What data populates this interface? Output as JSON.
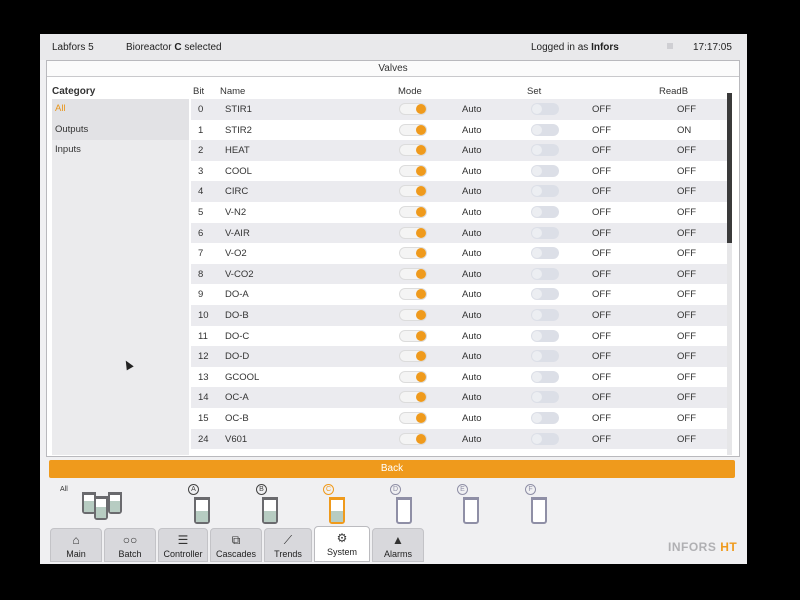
{
  "topbar": {
    "app_name": "Labfors 5",
    "bioreactor_prefix": "Bioreactor",
    "bioreactor_letter": "C",
    "bioreactor_suffix": "selected",
    "login_prefix": "Logged in as",
    "login_user": "Infors",
    "time": "17:17:05"
  },
  "panel": {
    "title": "Valves",
    "category_header": "Category",
    "categories": [
      {
        "label": "All",
        "active": true
      },
      {
        "label": "Outputs",
        "active": false
      },
      {
        "label": "Inputs",
        "active": false
      }
    ],
    "columns": {
      "bit": "Bit",
      "name": "Name",
      "mode": "Mode",
      "set": "Set",
      "readback": "ReadB"
    },
    "rows": [
      {
        "bit": "0",
        "name": "STIR1",
        "mode": "Auto",
        "set": "OFF",
        "readb": "OFF"
      },
      {
        "bit": "1",
        "name": "STIR2",
        "mode": "Auto",
        "set": "OFF",
        "readb": "ON"
      },
      {
        "bit": "2",
        "name": "HEAT",
        "mode": "Auto",
        "set": "OFF",
        "readb": "OFF"
      },
      {
        "bit": "3",
        "name": "COOL",
        "mode": "Auto",
        "set": "OFF",
        "readb": "OFF"
      },
      {
        "bit": "4",
        "name": "CIRC",
        "mode": "Auto",
        "set": "OFF",
        "readb": "OFF"
      },
      {
        "bit": "5",
        "name": "V-N2",
        "mode": "Auto",
        "set": "OFF",
        "readb": "OFF"
      },
      {
        "bit": "6",
        "name": "V-AIR",
        "mode": "Auto",
        "set": "OFF",
        "readb": "OFF"
      },
      {
        "bit": "7",
        "name": "V-O2",
        "mode": "Auto",
        "set": "OFF",
        "readb": "OFF"
      },
      {
        "bit": "8",
        "name": "V-CO2",
        "mode": "Auto",
        "set": "OFF",
        "readb": "OFF"
      },
      {
        "bit": "9",
        "name": "DO-A",
        "mode": "Auto",
        "set": "OFF",
        "readb": "OFF"
      },
      {
        "bit": "10",
        "name": "DO-B",
        "mode": "Auto",
        "set": "OFF",
        "readb": "OFF"
      },
      {
        "bit": "11",
        "name": "DO-C",
        "mode": "Auto",
        "set": "OFF",
        "readb": "OFF"
      },
      {
        "bit": "12",
        "name": "DO-D",
        "mode": "Auto",
        "set": "OFF",
        "readb": "OFF"
      },
      {
        "bit": "13",
        "name": "GCOOL",
        "mode": "Auto",
        "set": "OFF",
        "readb": "OFF"
      },
      {
        "bit": "14",
        "name": "OC-A",
        "mode": "Auto",
        "set": "OFF",
        "readb": "OFF"
      },
      {
        "bit": "15",
        "name": "OC-B",
        "mode": "Auto",
        "set": "OFF",
        "readb": "OFF"
      },
      {
        "bit": "24",
        "name": "V601",
        "mode": "Auto",
        "set": "OFF",
        "readb": "OFF"
      }
    ],
    "back_label": "Back"
  },
  "reactors": {
    "all_label": "All",
    "items": [
      {
        "letter": "A",
        "selected": false
      },
      {
        "letter": "B",
        "selected": false
      },
      {
        "letter": "C",
        "selected": true
      },
      {
        "letter": "D",
        "selected": false
      },
      {
        "letter": "E",
        "selected": false
      },
      {
        "letter": "F",
        "selected": false
      }
    ]
  },
  "tabs": [
    {
      "label": "Main",
      "icon": "home-icon",
      "glyph": "⌂",
      "active": false
    },
    {
      "label": "Batch",
      "icon": "batch-icon",
      "glyph": "○○",
      "active": false
    },
    {
      "label": "Controller",
      "icon": "controller-icon",
      "glyph": "☰",
      "active": false
    },
    {
      "label": "Cascades",
      "icon": "cascades-icon",
      "glyph": "⧉",
      "active": false
    },
    {
      "label": "Trends",
      "icon": "trends-icon",
      "glyph": "⟋",
      "active": false
    },
    {
      "label": "System",
      "icon": "gear-icon",
      "glyph": "⚙",
      "active": true
    },
    {
      "label": "Alarms",
      "icon": "alarm-icon",
      "glyph": "▲",
      "active": false
    }
  ],
  "brand": {
    "name": "INFORS",
    "suffix": "HT"
  },
  "colors": {
    "accent": "#ef9a1c",
    "background": "#f0f0f2"
  }
}
